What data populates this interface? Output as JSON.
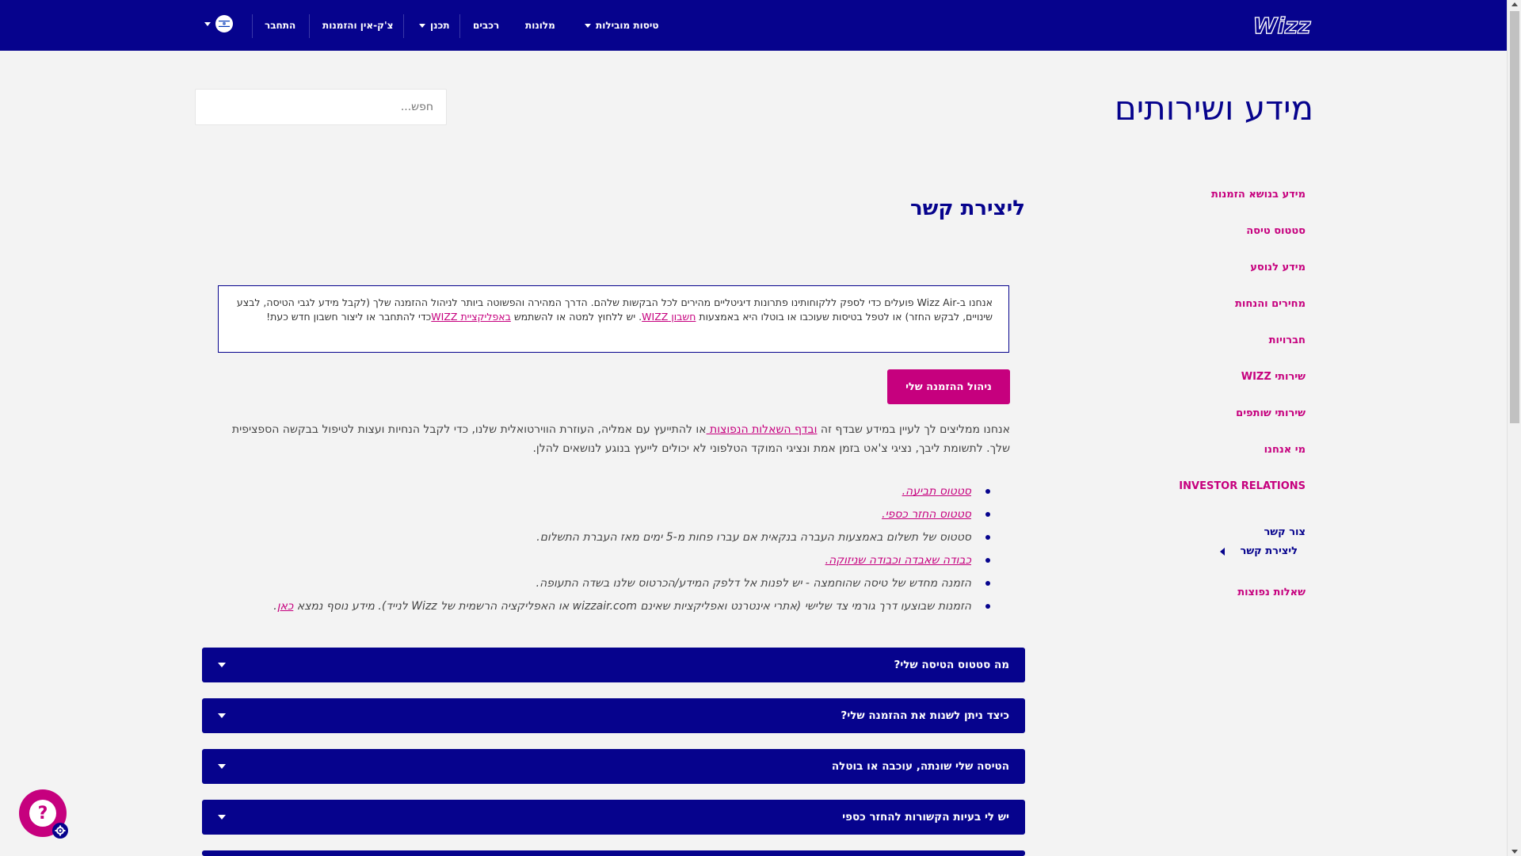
{
  "header": {
    "logo_text": "Wizz",
    "nav": {
      "flights": "טיסות מובילות",
      "hotels": "מלונות",
      "cars": "רכבים",
      "plan": "תכנן",
      "checkin": "צ'ק-אין והזמנות",
      "login": "התחבר"
    },
    "language_flag": "israel-flag-icon"
  },
  "page": {
    "title": "מידע ושירותים",
    "search_placeholder": "חפש..."
  },
  "sidebar": {
    "items": [
      "מידע בנושא הזמנות",
      "סטטוס טיסה",
      "מידע לנוסע",
      "מחירים והנחות",
      "חברויות",
      "שירותי WIZZ",
      "שירותי שותפים",
      "מי אנחנו",
      "INVESTOR RELATIONS"
    ],
    "group_title": "צור קשר",
    "active_sub": "ליצירת קשר",
    "faq": "שאלות נפוצות"
  },
  "main": {
    "title": "ליצירת קשר",
    "info_box": {
      "part1": "אנחנו ב-Wizz Air פועלים כדי לספק ללקוחותינו פתרונות דיגיטליים מהירים לכל הבקשות שלהם. הדרך המהירה והפשוטה ביותר לניהול ההזמנה שלך (לקבל מידע לגבי הטיסה, לבצע שינויים, לבקש החזר) או לטפל בטיסות שעוכבו או בוטלו היא באמצעות ",
      "link1": "חשבון WIZZ",
      "part2": ". יש ללחוץ למטה או להשתמש ",
      "link2": "באפליקציית WIZZ",
      "part3": "כדי להתחבר או ליצור חשבון חדש כעת!"
    },
    "manage_button": "ניהול ההזמנה שלי",
    "paragraph": {
      "part1": "אנחנו ממליצים לך לעיין במידע שבדף זה ",
      "link": "ובדף השאלות הנפוצות ",
      "part2": "או להתייעץ עם אמליה, העוזרת הווירטואלית שלנו, כדי לקבל הנחיות ועצות לטיפול בבקשה הספציפית שלך. לתשומת ליבך, נציגי צ'אט בזמן אמת ונציגי המוקד הטלפוני לא יכולים לייעץ בנוגע לנושאים להלן."
    },
    "bullets": [
      {
        "text": "",
        "link": "סטטוס תביעה."
      },
      {
        "text": "",
        "link": "סטטוס החזר כספי."
      },
      {
        "text": "סטטוס של תשלום באמצעות העברה בנקאית אם עברו פחות מ-5 ימים מאז העברת התשלום.",
        "link": ""
      },
      {
        "text": "",
        "link": "כבודה שאבדה וכבודה שניזוקה."
      },
      {
        "text": "הזמנה מחדש של טיסה שהוחמצה - יש לפנות אל דלפק המידע/הכרטוס שלנו בשדה התעופה.",
        "link": ""
      },
      {
        "text": "הזמנות שבוצעו דרך גורמי צד שלישי (אתרי אינטרנט ואפליקציות שאינם wizzair.com או האפליקציה הרשמית של Wizz לנייד). מידע נוסף נמצא ",
        "link": "כאן",
        "suffix": "."
      }
    ],
    "accordions": [
      "מה סטטוס הטיסה שלי?",
      "כיצד ניתן לשנות את ההזמנה שלי?",
      "הטיסה שלי שונתה, עוכבה או בוטלה",
      "יש לי בעיות הקשורות להחזר כספי"
    ]
  },
  "help_widget": {
    "symbol": "?"
  },
  "colors": {
    "brand_navy": "#06038d",
    "brand_magenta": "#c6007e",
    "page_bg": "#f3f3f3"
  }
}
